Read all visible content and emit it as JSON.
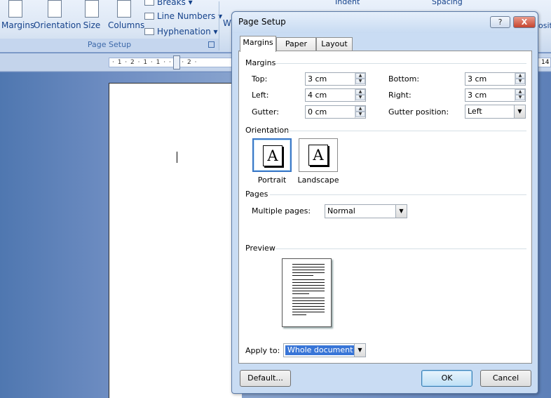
{
  "ribbon": {
    "buttons": [
      {
        "label": "Margins"
      },
      {
        "label": "Orientation"
      },
      {
        "label": "Size"
      },
      {
        "label": "Columns"
      }
    ],
    "small_buttons": [
      {
        "label": "Breaks ▾"
      },
      {
        "label": "Line Numbers ▾"
      },
      {
        "label": "Hyphenation ▾"
      }
    ],
    "group_label": "Page Setup",
    "partial_labels": {
      "indent": "Indent",
      "spacing": "Spacing",
      "w": "W",
      "posit": "ositi"
    }
  },
  "ruler": {
    "text": "· 1 · 2 · 1 · 1 · · 1 · 2 ·",
    "right_text": "14"
  },
  "dialog": {
    "title": "Page Setup",
    "help_label": "?",
    "close_label": "X",
    "tabs": [
      {
        "label": "Margins",
        "active": true
      },
      {
        "label": "Paper",
        "active": false
      },
      {
        "label": "Layout",
        "active": false
      }
    ],
    "margins": {
      "section_label": "Margins",
      "top": {
        "label": "Top:",
        "value": "3 cm"
      },
      "bottom": {
        "label": "Bottom:",
        "value": "3 cm"
      },
      "left": {
        "label": "Left:",
        "value": "4 cm"
      },
      "right": {
        "label": "Right:",
        "value": "3 cm"
      },
      "gutter": {
        "label": "Gutter:",
        "value": "0 cm"
      },
      "gutter_position": {
        "label": "Gutter position:",
        "value": "Left"
      }
    },
    "orientation": {
      "section_label": "Orientation",
      "portrait": {
        "label": "Portrait",
        "glyph": "A",
        "selected": true
      },
      "landscape": {
        "label": "Landscape",
        "glyph": "A",
        "selected": false
      }
    },
    "pages": {
      "section_label": "Pages",
      "multiple_pages_label": "Multiple pages:",
      "multiple_pages_value": "Normal"
    },
    "preview": {
      "section_label": "Preview"
    },
    "apply_to": {
      "label": "Apply to:",
      "value": "Whole document"
    },
    "buttons": {
      "default": "Default...",
      "ok": "OK",
      "cancel": "Cancel"
    },
    "colors": {
      "selection": "#3875d7",
      "frame": "#c9dcf3",
      "close": "#c6452f"
    }
  }
}
